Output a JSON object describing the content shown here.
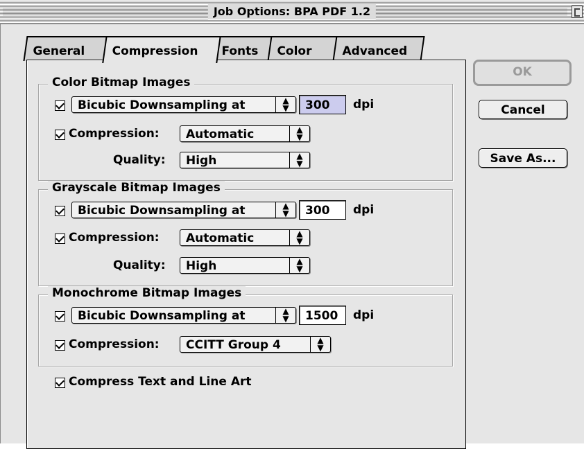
{
  "window": {
    "title": "Job Options: BPA PDF 1.2"
  },
  "tabs": [
    {
      "label": "General",
      "active": false
    },
    {
      "label": "Compression",
      "active": true
    },
    {
      "label": "Fonts",
      "active": false
    },
    {
      "label": "Color",
      "active": false
    },
    {
      "label": "Advanced",
      "active": false
    }
  ],
  "color_bitmap": {
    "title": "Color Bitmap Images",
    "downsample_checked": true,
    "downsample_method": "Bicubic Downsampling at",
    "resolution": "300",
    "unit": "dpi",
    "compression_checked": true,
    "compression_label": "Compression:",
    "compression_value": "Automatic",
    "quality_label": "Quality:",
    "quality_value": "High"
  },
  "grayscale_bitmap": {
    "title": "Grayscale Bitmap Images",
    "downsample_checked": true,
    "downsample_method": "Bicubic Downsampling at",
    "resolution": "300",
    "unit": "dpi",
    "compression_checked": true,
    "compression_label": "Compression:",
    "compression_value": "Automatic",
    "quality_label": "Quality:",
    "quality_value": "High"
  },
  "monochrome_bitmap": {
    "title": "Monochrome Bitmap Images",
    "downsample_checked": true,
    "downsample_method": "Bicubic Downsampling at",
    "resolution": "1500",
    "unit": "dpi",
    "compression_checked": true,
    "compression_label": "Compression:",
    "compression_value": "CCITT Group 4"
  },
  "compress_text": {
    "checked": true,
    "label": "Compress Text and Line Art"
  },
  "buttons": {
    "ok": "OK",
    "cancel": "Cancel",
    "save_as": "Save As..."
  },
  "icons": {
    "popup_arrows": "updown-arrows-icon",
    "checkbox": "checkmark-icon",
    "collapse": "window-collapse-icon"
  }
}
